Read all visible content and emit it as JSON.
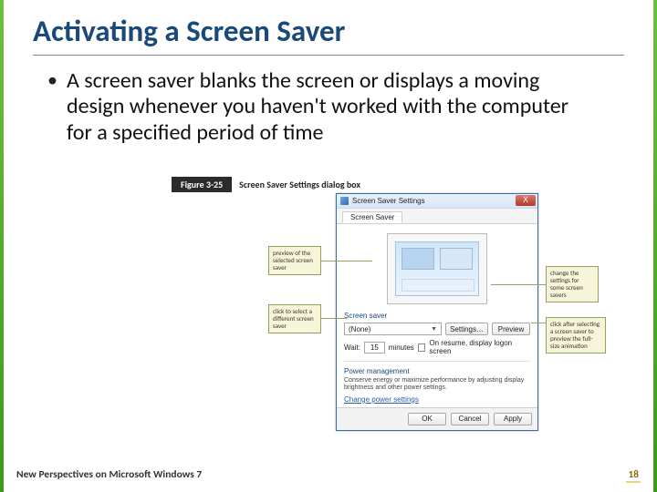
{
  "slide": {
    "title": "Activating a Screen Saver",
    "bullet": "A screen saver blanks the screen or displays a moving design whenever you haven't worked with the computer for a specified period of time"
  },
  "figure": {
    "label": "Figure 3-25",
    "caption": "Screen Saver Settings dialog box"
  },
  "dialog": {
    "title": "Screen Saver Settings",
    "close": "X",
    "tab": "Screen Saver",
    "section_label": "Screen saver",
    "selected": "(None)",
    "settings_btn": "Settings…",
    "preview_btn": "Preview",
    "wait_label": "Wait:",
    "wait_value": "15",
    "wait_unit": "minutes",
    "resume_label": "On resume, display logon screen",
    "pm_heading": "Power management",
    "pm_text": "Conserve energy or maximize performance by adjusting display brightness and other power settings.",
    "pm_link": "Change power settings",
    "ok": "OK",
    "cancel": "Cancel",
    "apply": "Apply"
  },
  "callouts": {
    "preview": "preview of the selected screen saver",
    "select": "click to select a different screen saver",
    "settings": "change the settings for some screen savers",
    "previewbtn": "click after selecting a screen saver to preview the full-size animation"
  },
  "footer": {
    "book": "New Perspectives on Microsoft Windows 7",
    "page": "18"
  }
}
